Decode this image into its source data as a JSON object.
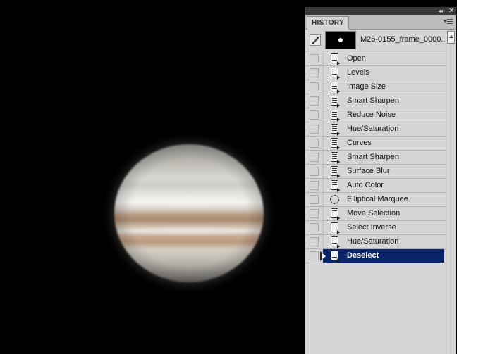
{
  "panel": {
    "tab_label": "HISTORY",
    "collapse_glyph": "◂◂",
    "close_glyph": "✕"
  },
  "snapshot": {
    "name": "M26-0155_frame_0000..."
  },
  "history": [
    {
      "label": "Open",
      "icon": "document-icon"
    },
    {
      "label": "Levels",
      "icon": "document-icon"
    },
    {
      "label": "Image Size",
      "icon": "document-icon"
    },
    {
      "label": "Smart Sharpen",
      "icon": "document-icon"
    },
    {
      "label": "Reduce Noise",
      "icon": "document-icon"
    },
    {
      "label": "Hue/Saturation",
      "icon": "document-icon"
    },
    {
      "label": "Curves",
      "icon": "document-icon"
    },
    {
      "label": "Smart Sharpen",
      "icon": "document-icon"
    },
    {
      "label": "Surface Blur",
      "icon": "document-icon"
    },
    {
      "label": "Auto Color",
      "icon": "document-icon"
    },
    {
      "label": "Elliptical Marquee",
      "icon": "elliptical-marquee-icon"
    },
    {
      "label": "Move Selection",
      "icon": "document-icon"
    },
    {
      "label": "Select Inverse",
      "icon": "document-icon"
    },
    {
      "label": "Hue/Saturation",
      "icon": "document-icon"
    },
    {
      "label": "Deselect",
      "icon": "document-icon",
      "selected": true
    }
  ],
  "colors": {
    "selection": "#0a246a",
    "panel_bg": "#d5d5d5",
    "canvas_bg": "#000000"
  }
}
